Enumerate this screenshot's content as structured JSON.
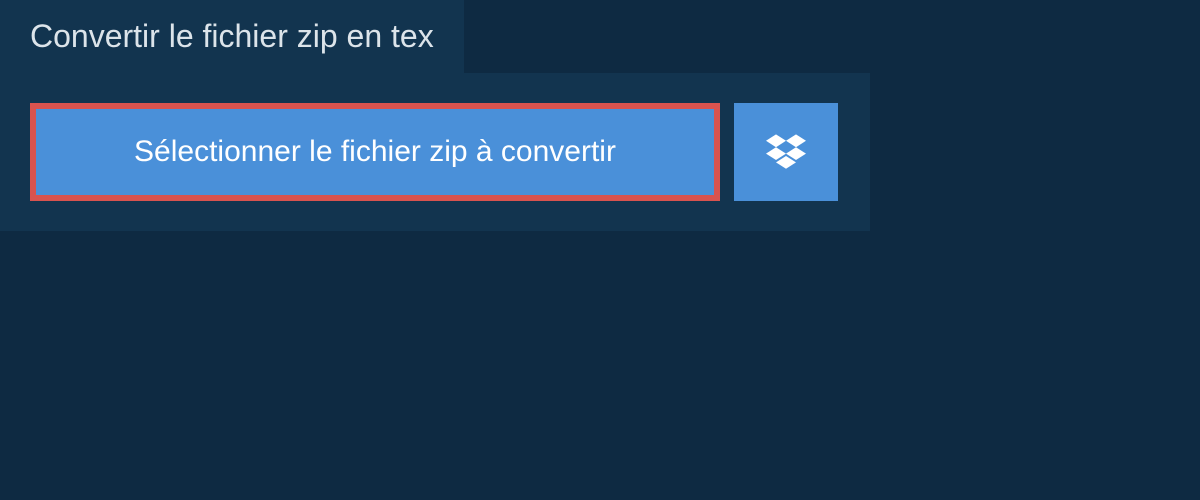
{
  "tab": {
    "title": "Convertir le fichier zip en tex"
  },
  "actions": {
    "select_file_label": "Sélectionner le fichier zip à convertir"
  },
  "colors": {
    "page_bg": "#0e2a42",
    "panel_bg": "#12344f",
    "button_bg": "#4a90d9",
    "highlight_border": "#d9534f",
    "text_light": "#ffffff",
    "text_muted": "#dce4ea"
  }
}
